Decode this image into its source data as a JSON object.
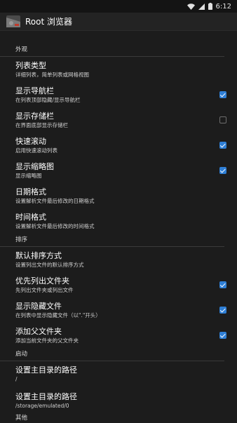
{
  "status_bar": {
    "time": "6:12"
  },
  "app_bar": {
    "title": "Root 浏览器",
    "icon": "app-logo-icon"
  },
  "sections": {
    "appearance": {
      "label": "外观"
    },
    "sort": {
      "label": "排序"
    },
    "startup": {
      "label": "启动"
    },
    "other": {
      "label": "其他"
    }
  },
  "prefs": {
    "list_type": {
      "title": "列表类型",
      "summary": "详细列表，简单列表或网格视图"
    },
    "show_navbar": {
      "title": "显示导航栏",
      "summary": "在列表顶部隐藏/显示导航栏",
      "checked": true
    },
    "show_storagebar": {
      "title": "显示存储栏",
      "summary": "在界面底部显示存储栏",
      "checked": false
    },
    "fast_scroll": {
      "title": "快速滚动",
      "summary": "启用快速滚动列表",
      "checked": true
    },
    "show_thumbnails": {
      "title": "显示缩略图",
      "summary": "显示缩略图",
      "checked": true
    },
    "date_format": {
      "title": "日期格式",
      "summary": "设置解析文件最后修改的日期格式"
    },
    "time_format": {
      "title": "时间格式",
      "summary": "设置解析文件最后修改的时间格式"
    },
    "default_sort": {
      "title": "默认排序方式",
      "summary": "设置列出文件的默认排序方式"
    },
    "folders_first": {
      "title": "优先列出文件夹",
      "summary": "先列出文件夹或列出文件",
      "checked": true
    },
    "show_hidden": {
      "title": "显示隐藏文件",
      "summary": "在列表中显示隐藏文件（以\".\"开头）",
      "checked": true
    },
    "add_parent": {
      "title": "添加父文件夹",
      "summary": "添加当前文件夹的父文件夹",
      "checked": true
    },
    "home_path_1": {
      "title": "设置主目录的路径",
      "summary": "/"
    },
    "home_path_2": {
      "title": "设置主目录的路径",
      "summary": "/storage/emulated/0"
    }
  },
  "colors": {
    "accent": "#2f7fd6",
    "background": "#1c1c1c"
  }
}
